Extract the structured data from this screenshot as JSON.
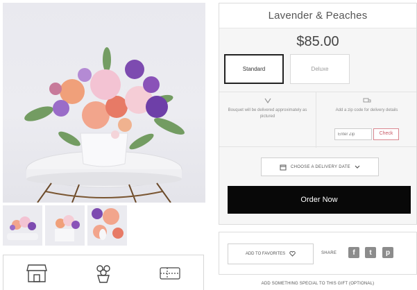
{
  "product": {
    "name": "Lavender & Peaches",
    "price": "$85.00"
  },
  "sizes": [
    {
      "label": "Standard",
      "selected": true
    },
    {
      "label": "Deluxe",
      "selected": false
    }
  ],
  "delivery_info": {
    "bouquet_note": "Bouquet will be delivered approximately as pictured",
    "zip_prompt": "Add a zip code for delivery details",
    "zip_placeholder": "Enter Zip",
    "check_label": "Check"
  },
  "date_button": {
    "label": "CHOOSE A DELIVERY DATE",
    "icon": "calendar-icon"
  },
  "order_button": "Order Now",
  "favorites_button": "ADD TO FAVORITES",
  "share": {
    "label": "SHARE",
    "networks": [
      "facebook-icon",
      "twitter-icon",
      "pinterest-icon"
    ]
  },
  "addon_heading": "ADD SOMETHING SPECIAL TO THIS GIFT (OPTIONAL)",
  "features": [
    "storefront-icon",
    "bouquet-icon",
    "gift-card-icon"
  ],
  "colors": {
    "accent_check": "#c85a66",
    "order_bg": "#080808"
  }
}
